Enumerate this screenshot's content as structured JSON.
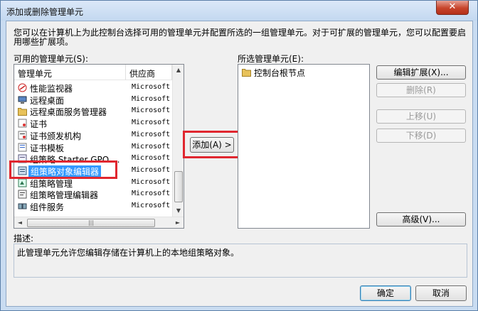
{
  "window": {
    "title": "添加或删除管理单元",
    "close_glyph": "✕"
  },
  "description": "您可以在计算机上为此控制台选择可用的管理单元并配置所选的一组管理单元。对于可扩展的管理单元，您可以配置要启用哪些扩展项。",
  "available": {
    "label": "可用的管理单元(S):",
    "col_name": "管理单元",
    "col_vendor": "供应商",
    "items": [
      {
        "name": "性能监视器",
        "vendor": "Microsoft",
        "icon": "perf-monitor-icon"
      },
      {
        "name": "远程桌面",
        "vendor": "Microsoft",
        "icon": "remote-desktop-icon"
      },
      {
        "name": "远程桌面服务管理器",
        "vendor": "Microsoft",
        "icon": "folder-icon"
      },
      {
        "name": "证书",
        "vendor": "Microsoft",
        "icon": "certificate-icon"
      },
      {
        "name": "证书颁发机构",
        "vendor": "Microsoft",
        "icon": "certificate-authority-icon"
      },
      {
        "name": "证书模板",
        "vendor": "Microsoft",
        "icon": "certificate-template-icon"
      },
      {
        "name": "组策略 Starter GPO ...",
        "vendor": "Microsoft",
        "icon": "gpo-icon"
      },
      {
        "name": "组策略对象编辑器",
        "vendor": "Microsoft",
        "icon": "gpo-editor-icon",
        "selected": true
      },
      {
        "name": "组策略管理",
        "vendor": "Microsoft",
        "icon": "gpo-management-icon"
      },
      {
        "name": "组策略管理编辑器",
        "vendor": "Microsoft",
        "icon": "gpo-management-editor-icon"
      },
      {
        "name": "组件服务",
        "vendor": "Microsoft",
        "icon": "component-services-icon"
      }
    ],
    "scroll_up": "▲",
    "scroll_down": "▼",
    "scroll_left": "◄",
    "scroll_right": "►",
    "hthumb_grip": "|||"
  },
  "add_button": "添加(A) >",
  "selected": {
    "label": "所选管理单元(E):",
    "items": [
      {
        "name": "控制台根节点",
        "icon": "folder-icon"
      }
    ]
  },
  "buttons": {
    "edit_extensions": "编辑扩展(X)...",
    "remove": "删除(R)",
    "move_up": "上移(U)",
    "move_down": "下移(D)",
    "advanced": "高级(V)...",
    "ok": "确定",
    "cancel": "取消"
  },
  "desc_label": "描述:",
  "desc_text": "此管理单元允许您编辑存储在计算机上的本地组策略对象。",
  "colors": {
    "selection": "#3399ff",
    "highlight_box": "#e0262f",
    "folder": "#e8c25a"
  }
}
